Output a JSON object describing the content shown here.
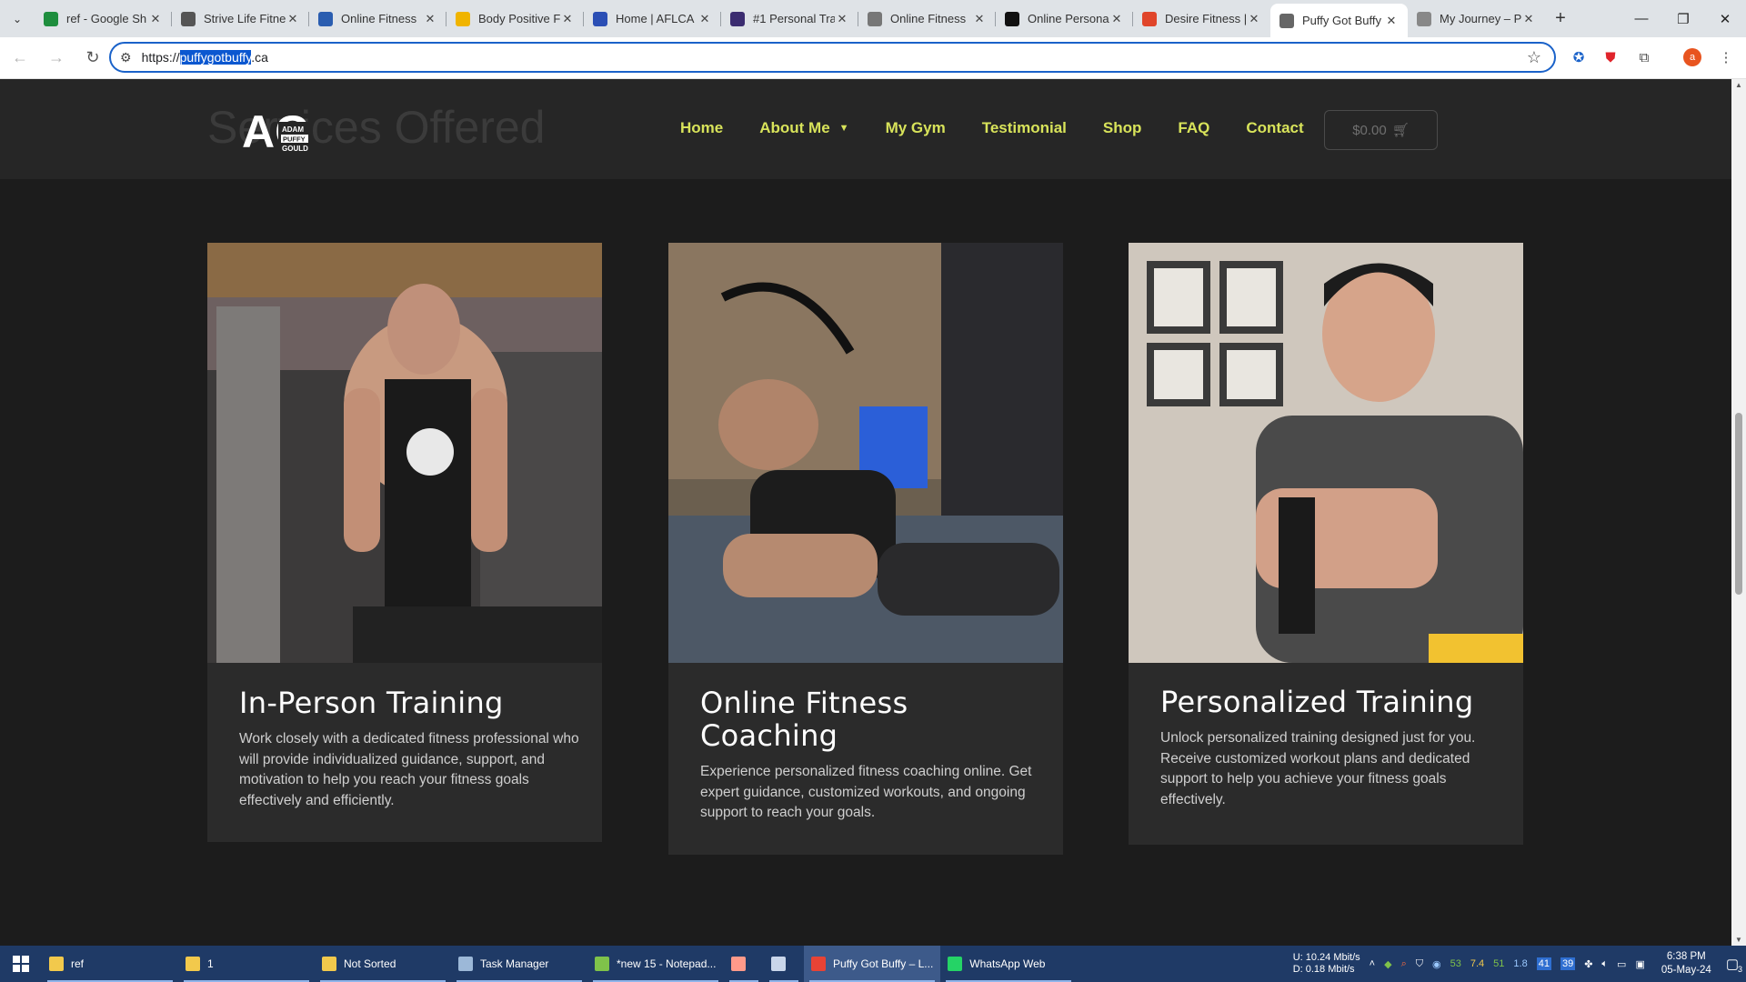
{
  "browser": {
    "tabs": [
      {
        "title": "ref - Google Sh",
        "favicon": "sheets-icon",
        "color": "#1e8e3e",
        "active": false
      },
      {
        "title": "Strive Life Fitne",
        "favicon": "site-icon",
        "color": "#555555",
        "active": false
      },
      {
        "title": "Online Fitness",
        "favicon": "check-icon",
        "color": "#2a5db0",
        "active": false
      },
      {
        "title": "Body Positive F",
        "favicon": "bird-icon",
        "color": "#f0b400",
        "active": false
      },
      {
        "title": "Home | AFLCA",
        "favicon": "bars-icon",
        "color": "#2b4fb5",
        "active": false
      },
      {
        "title": "#1 Personal Tra",
        "favicon": "shield-icon",
        "color": "#3b2c70",
        "active": false
      },
      {
        "title": "Online Fitness",
        "favicon": "circle-icon",
        "color": "#777777",
        "active": false
      },
      {
        "title": "Online Persona",
        "favicon": "k-icon",
        "color": "#111111",
        "active": false
      },
      {
        "title": "Desire Fitness |",
        "favicon": "swirl-icon",
        "color": "#e0452a",
        "active": false
      },
      {
        "title": "Puffy Got Buffy",
        "favicon": "lifter-icon",
        "color": "#666666",
        "active": true
      },
      {
        "title": "My Journey – P",
        "favicon": "lifter-icon",
        "color": "#888888",
        "active": false
      }
    ],
    "url_prefix": "https://",
    "url_selected": "puffygotbuffy",
    "url_suffix": ".ca",
    "profile_initial": "a",
    "accent": "#1a62c9"
  },
  "site": {
    "ghost_title": "Services Offered",
    "logo_letters": "AG",
    "logo_line1": "ADAM",
    "logo_line2": "PUFFY",
    "logo_line3": "GOULD",
    "nav": [
      "Home",
      "About Me",
      "My Gym",
      "Testimonial",
      "Shop",
      "FAQ",
      "Contact"
    ],
    "cart_total": "$0.00",
    "nav_color": "#d8e35a",
    "services": [
      {
        "title": "In-Person Training",
        "description": "Work closely with a dedicated fitness professional who will provide individualized guidance, support, and motivation to help you reach your fitness goals effectively and efficiently."
      },
      {
        "title": "Online Fitness Coaching",
        "description": "Experience personalized fitness coaching online. Get expert guidance, customized workouts, and ongoing support to reach your goals."
      },
      {
        "title": "Personalized Training",
        "description": "Unlock personalized training designed just for you. Receive customized workout plans and dedicated support to help you achieve your fitness goals effectively."
      }
    ]
  },
  "taskbar": {
    "items": [
      {
        "label": "ref",
        "icon": "folder-icon",
        "color": "#f2c94c",
        "active": false
      },
      {
        "label": "1",
        "icon": "folder-icon",
        "color": "#f2c94c",
        "active": false
      },
      {
        "label": "Not Sorted",
        "icon": "folder-icon",
        "color": "#f2c94c",
        "active": false
      },
      {
        "label": "Task Manager",
        "icon": "task-manager-icon",
        "color": "#9cb8d8",
        "active": false
      },
      {
        "label": "*new 15 - Notepad...",
        "icon": "notepad-icon",
        "color": "#7fc24a",
        "active": false
      },
      {
        "label": "",
        "icon": "app-icon",
        "color": "#ff9a8a",
        "active": false
      },
      {
        "label": "",
        "icon": "document-icon",
        "color": "#c9d6ea",
        "active": false
      },
      {
        "label": "Puffy Got Buffy – L...",
        "icon": "chrome-icon",
        "color": "#e84335",
        "active": true
      },
      {
        "label": "WhatsApp Web",
        "icon": "whatsapp-icon",
        "color": "#25d366",
        "active": false
      }
    ],
    "net_up_label": "U:",
    "net_up": "10.24 Mbit/s",
    "net_down_label": "D:",
    "net_down": "0.18 Mbit/s",
    "tray_numbers": [
      "53",
      "7.4",
      "51",
      "1.8"
    ],
    "tray_badges": [
      "41",
      "39"
    ],
    "time": "6:38 PM",
    "date": "05-May-24",
    "notification_count": "3"
  }
}
